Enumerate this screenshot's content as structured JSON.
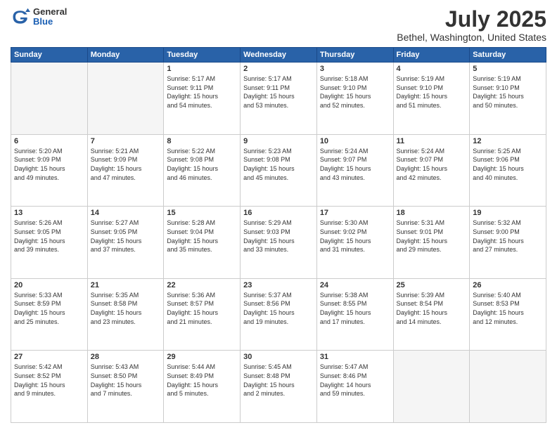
{
  "logo": {
    "general": "General",
    "blue": "Blue"
  },
  "header": {
    "title": "July 2025",
    "subtitle": "Bethel, Washington, United States"
  },
  "days_of_week": [
    "Sunday",
    "Monday",
    "Tuesday",
    "Wednesday",
    "Thursday",
    "Friday",
    "Saturday"
  ],
  "weeks": [
    [
      {
        "day": "",
        "info": ""
      },
      {
        "day": "",
        "info": ""
      },
      {
        "day": "1",
        "info": "Sunrise: 5:17 AM\nSunset: 9:11 PM\nDaylight: 15 hours\nand 54 minutes."
      },
      {
        "day": "2",
        "info": "Sunrise: 5:17 AM\nSunset: 9:11 PM\nDaylight: 15 hours\nand 53 minutes."
      },
      {
        "day": "3",
        "info": "Sunrise: 5:18 AM\nSunset: 9:10 PM\nDaylight: 15 hours\nand 52 minutes."
      },
      {
        "day": "4",
        "info": "Sunrise: 5:19 AM\nSunset: 9:10 PM\nDaylight: 15 hours\nand 51 minutes."
      },
      {
        "day": "5",
        "info": "Sunrise: 5:19 AM\nSunset: 9:10 PM\nDaylight: 15 hours\nand 50 minutes."
      }
    ],
    [
      {
        "day": "6",
        "info": "Sunrise: 5:20 AM\nSunset: 9:09 PM\nDaylight: 15 hours\nand 49 minutes."
      },
      {
        "day": "7",
        "info": "Sunrise: 5:21 AM\nSunset: 9:09 PM\nDaylight: 15 hours\nand 47 minutes."
      },
      {
        "day": "8",
        "info": "Sunrise: 5:22 AM\nSunset: 9:08 PM\nDaylight: 15 hours\nand 46 minutes."
      },
      {
        "day": "9",
        "info": "Sunrise: 5:23 AM\nSunset: 9:08 PM\nDaylight: 15 hours\nand 45 minutes."
      },
      {
        "day": "10",
        "info": "Sunrise: 5:24 AM\nSunset: 9:07 PM\nDaylight: 15 hours\nand 43 minutes."
      },
      {
        "day": "11",
        "info": "Sunrise: 5:24 AM\nSunset: 9:07 PM\nDaylight: 15 hours\nand 42 minutes."
      },
      {
        "day": "12",
        "info": "Sunrise: 5:25 AM\nSunset: 9:06 PM\nDaylight: 15 hours\nand 40 minutes."
      }
    ],
    [
      {
        "day": "13",
        "info": "Sunrise: 5:26 AM\nSunset: 9:05 PM\nDaylight: 15 hours\nand 39 minutes."
      },
      {
        "day": "14",
        "info": "Sunrise: 5:27 AM\nSunset: 9:05 PM\nDaylight: 15 hours\nand 37 minutes."
      },
      {
        "day": "15",
        "info": "Sunrise: 5:28 AM\nSunset: 9:04 PM\nDaylight: 15 hours\nand 35 minutes."
      },
      {
        "day": "16",
        "info": "Sunrise: 5:29 AM\nSunset: 9:03 PM\nDaylight: 15 hours\nand 33 minutes."
      },
      {
        "day": "17",
        "info": "Sunrise: 5:30 AM\nSunset: 9:02 PM\nDaylight: 15 hours\nand 31 minutes."
      },
      {
        "day": "18",
        "info": "Sunrise: 5:31 AM\nSunset: 9:01 PM\nDaylight: 15 hours\nand 29 minutes."
      },
      {
        "day": "19",
        "info": "Sunrise: 5:32 AM\nSunset: 9:00 PM\nDaylight: 15 hours\nand 27 minutes."
      }
    ],
    [
      {
        "day": "20",
        "info": "Sunrise: 5:33 AM\nSunset: 8:59 PM\nDaylight: 15 hours\nand 25 minutes."
      },
      {
        "day": "21",
        "info": "Sunrise: 5:35 AM\nSunset: 8:58 PM\nDaylight: 15 hours\nand 23 minutes."
      },
      {
        "day": "22",
        "info": "Sunrise: 5:36 AM\nSunset: 8:57 PM\nDaylight: 15 hours\nand 21 minutes."
      },
      {
        "day": "23",
        "info": "Sunrise: 5:37 AM\nSunset: 8:56 PM\nDaylight: 15 hours\nand 19 minutes."
      },
      {
        "day": "24",
        "info": "Sunrise: 5:38 AM\nSunset: 8:55 PM\nDaylight: 15 hours\nand 17 minutes."
      },
      {
        "day": "25",
        "info": "Sunrise: 5:39 AM\nSunset: 8:54 PM\nDaylight: 15 hours\nand 14 minutes."
      },
      {
        "day": "26",
        "info": "Sunrise: 5:40 AM\nSunset: 8:53 PM\nDaylight: 15 hours\nand 12 minutes."
      }
    ],
    [
      {
        "day": "27",
        "info": "Sunrise: 5:42 AM\nSunset: 8:52 PM\nDaylight: 15 hours\nand 9 minutes."
      },
      {
        "day": "28",
        "info": "Sunrise: 5:43 AM\nSunset: 8:50 PM\nDaylight: 15 hours\nand 7 minutes."
      },
      {
        "day": "29",
        "info": "Sunrise: 5:44 AM\nSunset: 8:49 PM\nDaylight: 15 hours\nand 5 minutes."
      },
      {
        "day": "30",
        "info": "Sunrise: 5:45 AM\nSunset: 8:48 PM\nDaylight: 15 hours\nand 2 minutes."
      },
      {
        "day": "31",
        "info": "Sunrise: 5:47 AM\nSunset: 8:46 PM\nDaylight: 14 hours\nand 59 minutes."
      },
      {
        "day": "",
        "info": ""
      },
      {
        "day": "",
        "info": ""
      }
    ]
  ]
}
